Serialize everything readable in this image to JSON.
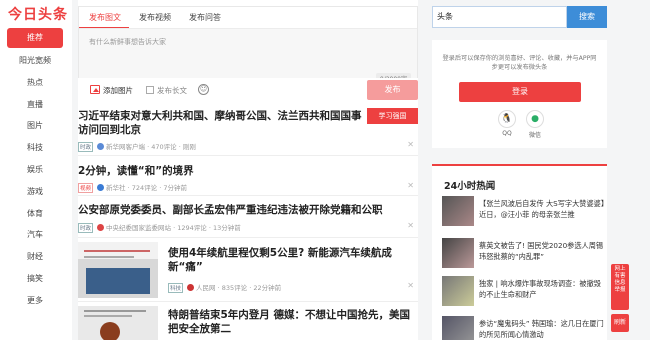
{
  "logo": "今日头条",
  "nav": [
    "推荐",
    "阳光宽频",
    "热点",
    "直播",
    "图片",
    "科技",
    "娱乐",
    "游戏",
    "体育",
    "汽车",
    "财经",
    "搞笑",
    "更多"
  ],
  "composer": {
    "tabs": [
      "发布图文",
      "发布视频",
      "发布问答"
    ],
    "placeholder": "有什么新鲜事想告诉大家",
    "count": "0/2000字",
    "add_image": "添加图片",
    "long_post": "发布长文",
    "publish": "发布"
  },
  "feed": [
    {
      "title": "习近平结束对意大利共和国、摩纳哥公国、法兰西共和国国事访问回到北京",
      "tag": "时政",
      "source": "新华网客户端",
      "comments": "470评论",
      "time": "刚刚",
      "ad": "学习强国"
    },
    {
      "title": "2分钟，读懂“和”的境界",
      "tag": "视频",
      "source": "新华社",
      "comments": "724评论",
      "time": "7分钟前"
    },
    {
      "title": "公安部原党委委员、副部长孟宏伟严重违纪违法被开除党籍和公职",
      "tag": "时政",
      "source": "中央纪委国家监委网站",
      "comments": "1294评论",
      "time": "13分钟前"
    },
    {
      "title": "使用4年续航里程仅剩5公里? 新能源汽车续航成新“痛”",
      "tag": "科技",
      "source": "人民网",
      "comments": "835评论",
      "time": "22分钟前"
    },
    {
      "title": "特朗普结束5年内登月 德媒：不想让中国抢先，美国把安全放第二"
    }
  ],
  "search": {
    "value": "头条",
    "button": "搜索"
  },
  "login": {
    "tip": "登录后可以保存你的浏览喜好、评论、收藏，并与APP同步更可以发布微头条",
    "button": "登录",
    "qq": "QQ",
    "wechat": "微信"
  },
  "hot": {
    "title": "24小时热闻",
    "items": [
      "【张兰风波后自发传 大S写字大赞婆婆】近日，@汪小菲 的母亲张兰推",
      "蔡英文被告了! 国民党2020参选人周锡玮怒批蔡的“内乱罪”",
      "独家 | 响水爆炸事故现场调查：被撤毁的不止生命和财产",
      "参访“魔鬼码头” 韩国瑜：这几日在厦门的所见所闻心情激动"
    ]
  },
  "float": {
    "report": "网上有害信息举报",
    "refresh": "刷新"
  }
}
